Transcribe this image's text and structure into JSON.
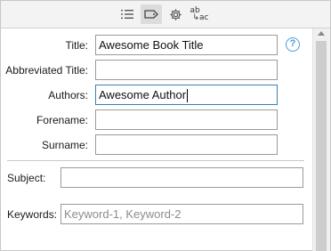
{
  "toolbar": {
    "buttons": [
      {
        "name": "list",
        "icon": "list-icon",
        "active": false
      },
      {
        "name": "tag",
        "icon": "tag-icon",
        "active": true
      },
      {
        "name": "settings",
        "icon": "gear-icon",
        "active": false
      },
      {
        "name": "abbreviate",
        "icon": "ab-ac-icon",
        "top_text": "ab",
        "bottom_text": "ac",
        "active": false
      }
    ]
  },
  "form": {
    "title": {
      "label": "Title:",
      "value": "Awesome Book Title"
    },
    "abbreviated_title": {
      "label": "Abbreviated Title:",
      "value": ""
    },
    "authors": {
      "label": "Authors:",
      "value": "Awesome Author"
    },
    "forename": {
      "label": "Forename:",
      "value": ""
    },
    "surname": {
      "label": "Surname:",
      "value": ""
    },
    "subject": {
      "label": "Subject:",
      "value": ""
    },
    "keywords": {
      "label": "Keywords:",
      "value": "",
      "placeholder": "Keyword-1, Keyword-2"
    }
  },
  "help": {
    "glyph": "?"
  },
  "colors": {
    "accent": "#3c7fb1",
    "help": "#4a9be0",
    "toolbar_bg": "#f3f3f3",
    "active_button_bg": "#dcdcdc"
  }
}
